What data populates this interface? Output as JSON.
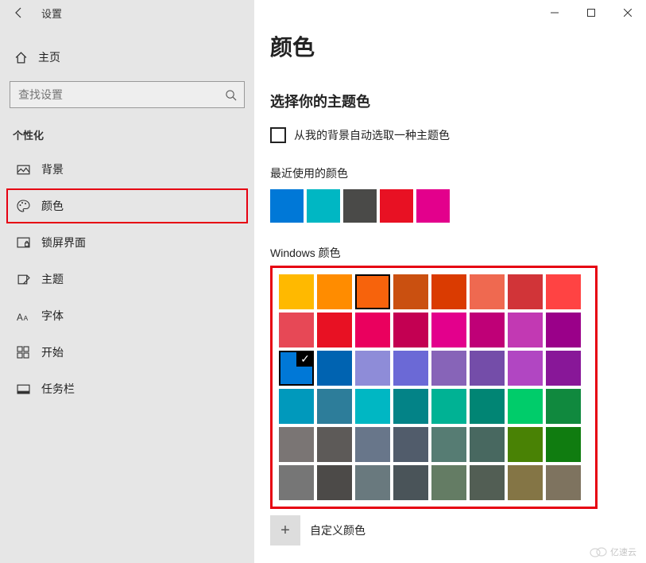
{
  "window": {
    "title": "设置"
  },
  "sidebar": {
    "home": "主页",
    "search_placeholder": "查找设置",
    "section": "个性化",
    "items": [
      {
        "label": "背景"
      },
      {
        "label": "颜色"
      },
      {
        "label": "锁屏界面"
      },
      {
        "label": "主题"
      },
      {
        "label": "字体"
      },
      {
        "label": "开始"
      },
      {
        "label": "任务栏"
      }
    ]
  },
  "main": {
    "title": "颜色",
    "subtitle": "选择你的主题色",
    "checkbox_label": "从我的背景自动选取一种主题色",
    "recent_label": "最近使用的颜色",
    "recent_colors": [
      "#0078d7",
      "#00b7c3",
      "#4a4a48",
      "#e81123",
      "#e3008c"
    ],
    "windows_label": "Windows 颜色",
    "custom_label": "自定义颜色",
    "colors": [
      [
        "#ffb900",
        "#ff8c00",
        "#f7630c",
        "#ca5010",
        "#da3b01",
        "#ef6950",
        "#d13438",
        "#ff4343"
      ],
      [
        "#e74856",
        "#e81123",
        "#ea005e",
        "#c30052",
        "#e3008c",
        "#bf0077",
        "#c239b3",
        "#9a0089"
      ],
      [
        "#0078d7",
        "#0063b1",
        "#8e8cd8",
        "#6b69d6",
        "#8764b8",
        "#744da9",
        "#b146c2",
        "#881798"
      ],
      [
        "#0099bc",
        "#2d7d9a",
        "#00b7c3",
        "#038387",
        "#00b294",
        "#018574",
        "#00cc6a",
        "#10893e"
      ],
      [
        "#7a7574",
        "#5d5a58",
        "#68768a",
        "#515c6b",
        "#567c73",
        "#486860",
        "#498205",
        "#107c10"
      ],
      [
        "#767676",
        "#4c4a48",
        "#69797e",
        "#4a5459",
        "#647c64",
        "#525e54",
        "#847545",
        "#7e735f"
      ]
    ],
    "outlined": {
      "row": 0,
      "col": 2
    },
    "selected": {
      "row": 2,
      "col": 0
    }
  },
  "watermark": "亿速云"
}
